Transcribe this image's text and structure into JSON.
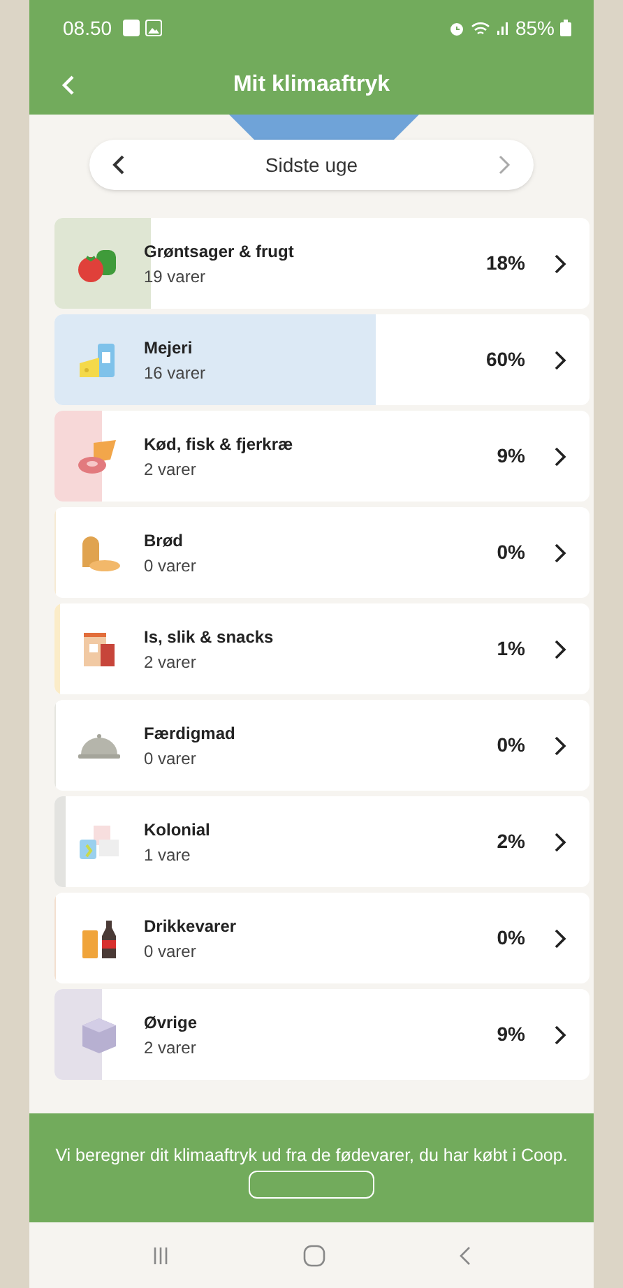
{
  "status_bar": {
    "time": "08.50",
    "battery": "85%"
  },
  "header": {
    "title": "Mit klimaaftryk"
  },
  "period": {
    "label": "Sidste uge"
  },
  "categories": [
    {
      "kind": "vegetables",
      "name": "Grøntsager & frugt",
      "count": "19 varer",
      "percent": "18%",
      "level": 0.18,
      "color": "#dfe6d3"
    },
    {
      "kind": "dairy",
      "name": "Mejeri",
      "count": "16 varer",
      "percent": "60%",
      "level": 0.6,
      "color": "#dce9f5"
    },
    {
      "kind": "meat",
      "name": "Kød, fisk & fjerkræ",
      "count": "2 varer",
      "percent": "9%",
      "level": 0.09,
      "color": "#f7d8d8"
    },
    {
      "kind": "bread",
      "name": "Brød",
      "count": "0 varer",
      "percent": "0%",
      "level": 0,
      "color": "#f6ead5"
    },
    {
      "kind": "snacks",
      "name": "Is, slik & snacks",
      "count": "2 varer",
      "percent": "1%",
      "level": 0.01,
      "color": "#fbecc8"
    },
    {
      "kind": "ready",
      "name": "Færdigmad",
      "count": "0 varer",
      "percent": "0%",
      "level": 0,
      "color": "#e5e5e0"
    },
    {
      "kind": "colonial",
      "name": "Kolonial",
      "count": "1 vare",
      "percent": "2%",
      "level": 0.02,
      "color": "#e3e3e0"
    },
    {
      "kind": "drinks",
      "name": "Drikkevarer",
      "count": "0 varer",
      "percent": "0%",
      "level": 0,
      "color": "#f3e0d0"
    },
    {
      "kind": "other",
      "name": "Øvrige",
      "count": "2 varer",
      "percent": "9%",
      "level": 0.09,
      "color": "#e4e0ea"
    }
  ],
  "footer": {
    "text": "Vi beregner dit klimaaftryk ud fra de fødevarer, du har købt i Coop."
  }
}
